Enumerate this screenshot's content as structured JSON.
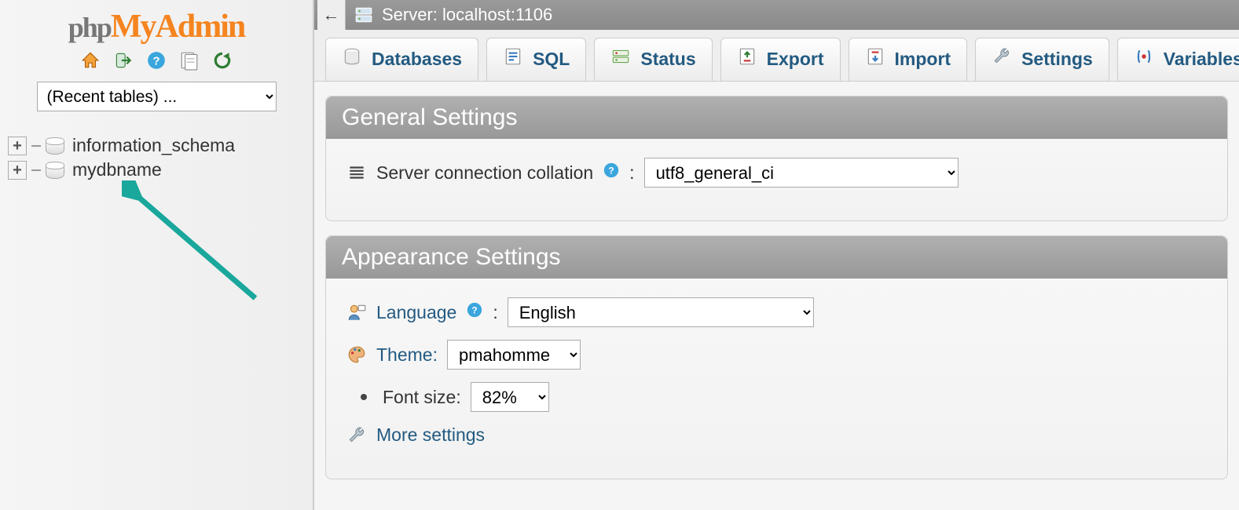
{
  "logo": {
    "part1": "php",
    "part2": "My",
    "part3": "Admin"
  },
  "sidebar": {
    "recent_tables_placeholder": "(Recent tables) ...",
    "databases": [
      {
        "name": "information_schema"
      },
      {
        "name": "mydbname"
      }
    ]
  },
  "topbar": {
    "back_glyph": "←",
    "server_label": "Server: localhost:1106"
  },
  "tabs": {
    "databases": "Databases",
    "sql": "SQL",
    "status": "Status",
    "export": "Export",
    "import": "Import",
    "settings": "Settings",
    "variables": "Variables"
  },
  "general": {
    "heading": "General Settings",
    "collation_label": "Server connection collation",
    "collation_value": "utf8_general_ci"
  },
  "appearance": {
    "heading": "Appearance Settings",
    "language_label": "Language",
    "language_value": "English",
    "theme_label": "Theme:",
    "theme_value": "pmahomme",
    "font_size_label": "Font size:",
    "font_size_value": "82%",
    "more_settings": "More settings"
  },
  "colon": ":"
}
